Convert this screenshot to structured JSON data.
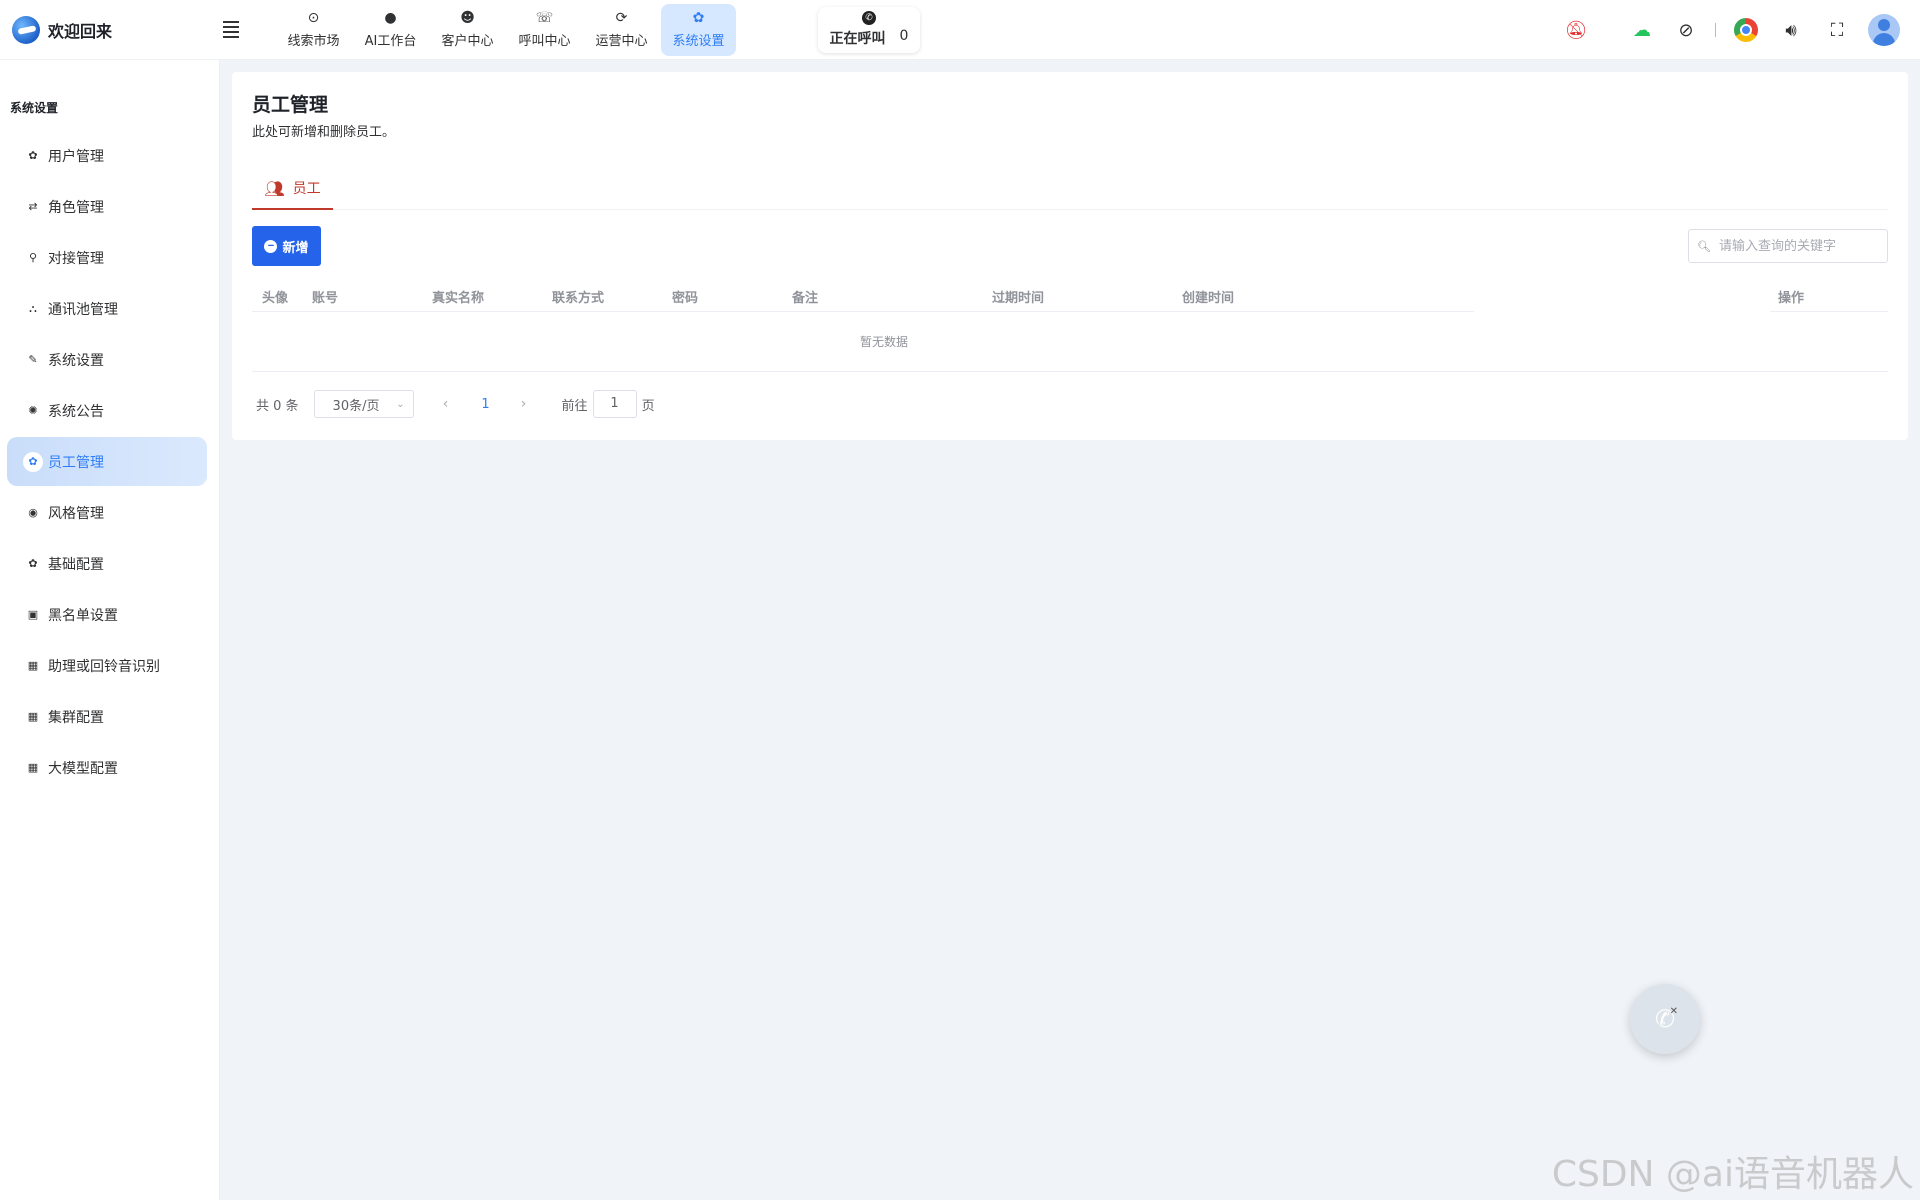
{
  "brand": {
    "title": "欢迎回来"
  },
  "nav": [
    {
      "label": "线索市场",
      "icon": "⊙",
      "active": false
    },
    {
      "label": "AI工作台",
      "icon": "●",
      "active": false
    },
    {
      "label": "客户中心",
      "icon": "☻",
      "active": false
    },
    {
      "label": "呼叫中心",
      "icon": "☏",
      "active": false
    },
    {
      "label": "运营中心",
      "icon": "⟳",
      "active": false
    },
    {
      "label": "系统设置",
      "icon": "✿",
      "active": true
    }
  ],
  "calling": {
    "label": "正在呼叫",
    "count": "0"
  },
  "sidebar": {
    "title": "系统设置",
    "items": [
      {
        "label": "用户管理",
        "icon": "✿"
      },
      {
        "label": "角色管理",
        "icon": "⇄"
      },
      {
        "label": "对接管理",
        "icon": "⚲"
      },
      {
        "label": "通讯池管理",
        "icon": "⛬"
      },
      {
        "label": "系统设置",
        "icon": "✎"
      },
      {
        "label": "系统公告",
        "icon": "✺"
      },
      {
        "label": "员工管理",
        "icon": "✿",
        "active": true
      },
      {
        "label": "风格管理",
        "icon": "◉"
      },
      {
        "label": "基础配置",
        "icon": "✿"
      },
      {
        "label": "黑名单设置",
        "icon": "▣"
      },
      {
        "label": "助理或回铃音识别",
        "icon": "▦"
      },
      {
        "label": "集群配置",
        "icon": "▦"
      },
      {
        "label": "大模型配置",
        "icon": "▦"
      }
    ]
  },
  "main": {
    "title": "员工管理",
    "subtitle": "此处可新增和删除员工。",
    "tab_label": "员工",
    "add_label": "新增",
    "search_placeholder": "请输入查询的关键字",
    "columns": [
      "头像",
      "账号",
      "真实名称",
      "联系方式",
      "密码",
      "备注",
      "过期时间",
      "创建时间",
      "操作"
    ],
    "empty_text": "暂无数据",
    "pager": {
      "total": "共 0 条",
      "size": "30条/页",
      "current": "1",
      "goto": "前往",
      "page_value": "1",
      "page_unit": "页"
    }
  },
  "watermark": "CSDN @ai语音机器人"
}
